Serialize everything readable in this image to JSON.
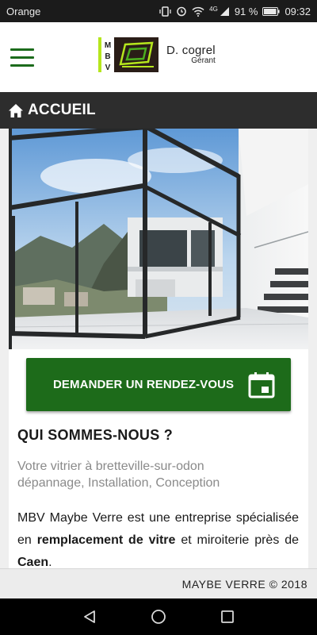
{
  "status": {
    "carrier": "Orange",
    "network": "4G",
    "battery": "91 %",
    "time": "09:32"
  },
  "header": {
    "logo_text": "MBV",
    "name": "D. cogrel",
    "role": "Gérant"
  },
  "nav": {
    "home_title": "ACCUEIL"
  },
  "cta": {
    "label": "DEMANDER UN RENDEZ-VOUS"
  },
  "about": {
    "title": "QUI SOMMES-NOUS ?",
    "subtitle_line1": "Votre vitrier à bretteville-sur-odon",
    "subtitle_line2": "dépannage, Installation, Conception",
    "para_start": "MBV Maybe Verre est une entreprise spécialisée en",
    "para_link1": "remplacement de vitre",
    "para_mid": "et miroiterie près de",
    "para_link2": "Caen",
    "para_end": "."
  },
  "footer": {
    "copyright": "MAYBE VERRE © 2018"
  },
  "colors": {
    "brand_green": "#1d6b1a",
    "nav_dark": "#2d2d2d",
    "logo_lime": "#b5e61d"
  }
}
